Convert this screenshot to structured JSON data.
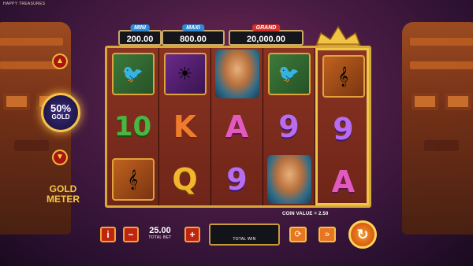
{
  "game": {
    "title_small": "HAPPY TREASURES",
    "icons": {
      "coin_value_prefix": "COIN VALUE ="
    }
  },
  "jackpots": {
    "mini": {
      "tag": "MINI",
      "value": "200.00",
      "tag_color": "#2f8ad8"
    },
    "maxi": {
      "tag": "MAXI",
      "value": "800.00",
      "tag_color": "#2f8ad8"
    },
    "grand": {
      "tag": "GRAND",
      "value": "20,000.00",
      "tag_color": "#d7312a"
    }
  },
  "gold_meter": {
    "percent": "50%",
    "word": "GOLD",
    "label_line1": "GOLD",
    "label_line2": "METER",
    "up_icon": "up-arrow-icon",
    "down_icon": "down-arrow-icon"
  },
  "reels": [
    [
      "bird-jewel",
      "10",
      "pan-flute"
    ],
    [
      "mask-jewel",
      "K",
      "Q"
    ],
    [
      "queen",
      "A",
      "9"
    ],
    [
      "bird-jewel",
      "9",
      "queen"
    ],
    [
      "pan-flute",
      "9",
      "A"
    ]
  ],
  "symbols_text": {
    "r0_1": "10",
    "r1_1": "K",
    "r1_2": "Q",
    "r2_1": "A",
    "r2_2": "9",
    "r3_1": "9",
    "r4_1": "9",
    "r4_2": "A"
  },
  "bottom_bar": {
    "info_label": "i",
    "minus_label": "−",
    "plus_label": "+",
    "total_bet_value": "25.00",
    "total_bet_label": "TOTAL BET",
    "total_win_label": "TOTAL WIN",
    "coin_value_label": "COIN VALUE =",
    "coin_value": "2.50",
    "autoplay_icon": "autoplay-icon",
    "turbo_icon": "turbo-icon",
    "spin_icon": "spin-icon"
  },
  "colors": {
    "frame_gold": "#d8a83a",
    "background": "#4a1c44",
    "button_red": "#c0240f",
    "button_orange": "#e67620"
  }
}
